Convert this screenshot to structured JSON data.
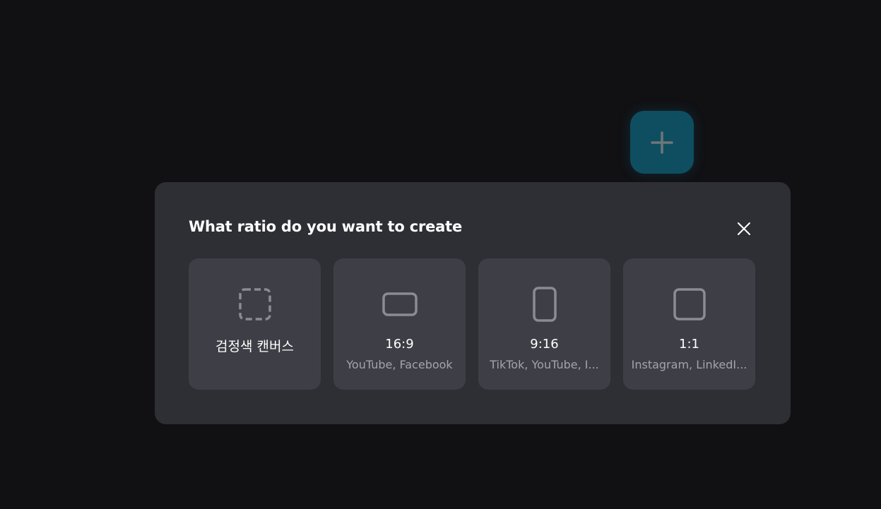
{
  "add_button": {
    "icon": "plus-icon",
    "color": "#0e4e60"
  },
  "dialog": {
    "title": "What ratio do you want to create",
    "close_icon": "close-icon",
    "options": [
      {
        "label": "검정색 캔버스",
        "subtitle": "",
        "icon": "dashed-square-icon"
      },
      {
        "label": "16:9",
        "subtitle": "YouTube, Facebook",
        "icon": "landscape-rect-icon"
      },
      {
        "label": "9:16",
        "subtitle": "TikTok, YouTube, I...",
        "icon": "portrait-rect-icon"
      },
      {
        "label": "1:1",
        "subtitle": "Instagram, LinkedI...",
        "icon": "square-icon"
      }
    ]
  },
  "colors": {
    "background": "#111114",
    "dialog": "#2e2f34",
    "card": "#3e3f46",
    "icon_stroke": "#8b8c93",
    "subtitle": "#a3a4ab"
  }
}
